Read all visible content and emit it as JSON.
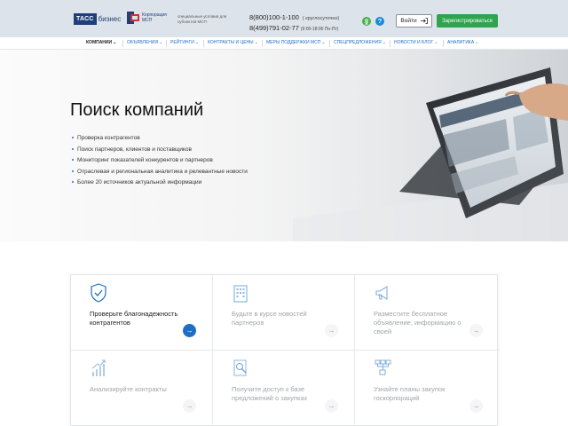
{
  "header": {
    "tass_logo": "ТАСС",
    "tass_logo_suffix": "бизнес",
    "msp_logo_text": "Корпорация МСП",
    "msp_subtitle": "специальные условия для субъектов МСП",
    "phone1": "8(800)100-1-100",
    "phone1_note": "( круглосуточно)",
    "phone2": "8(499)791-02-77",
    "phone2_note": "(9:00-18:00 Пн-Пт)",
    "ok_icon_glyph": "ok",
    "help_icon_glyph": "?",
    "login_label": "Войти",
    "register_label": "Зарегистрироваться"
  },
  "nav": {
    "items": [
      {
        "label": "Компании"
      },
      {
        "label": "Объявления"
      },
      {
        "label": "Рейтинги"
      },
      {
        "label": "Контракты и цены"
      },
      {
        "label": "Меры поддержки МСП"
      },
      {
        "label": "Спецпредложения"
      },
      {
        "label": "Новости и блог"
      },
      {
        "label": "Аналитика"
      }
    ]
  },
  "hero": {
    "title": "Поиск компаний",
    "bullets": [
      "Проверка контрагентов",
      "Поиск партнеров, клиентов и поставщиков",
      "Мониторинг показателей конкурентов и партнеров",
      "Отраслевая и региональная аналитика и релевантные новости",
      "Более 20 источников актуальной информации"
    ]
  },
  "cards": [
    {
      "label": "Проверьте благонадежность контрагентов",
      "icon": "shield-check-icon"
    },
    {
      "label": "Будьте в курсе новостей партнеров",
      "icon": "building-icon"
    },
    {
      "label": "Разместите бесплатное объявление, информацию о своей",
      "icon": "megaphone-icon"
    },
    {
      "label": "Анализируйте контракты",
      "icon": "chart-growth-icon"
    },
    {
      "label": "Получите доступ к базе предложений о закупках",
      "icon": "search-document-icon"
    },
    {
      "label": "Узнайте планы закупок госкорпораций",
      "icon": "org-chart-icon"
    }
  ],
  "colors": {
    "accent": "#1e6fc4",
    "register_green": "#2ea44f",
    "header_bg": "#dde3ea"
  }
}
